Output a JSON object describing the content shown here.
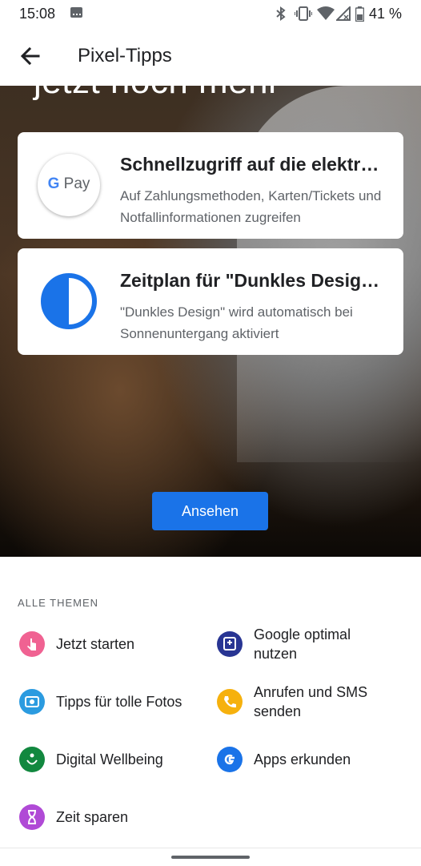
{
  "status_bar": {
    "time": "15:08",
    "battery_percent": "41 %",
    "icons": [
      "notification-icon",
      "bluetooth-icon",
      "vibrate-icon",
      "wifi-icon",
      "cell-signal-icon",
      "battery-icon"
    ]
  },
  "app_bar": {
    "title": "Pixel-Tipps",
    "back_icon": "arrow-back-icon"
  },
  "hero": {
    "headline": "jetzt noch mehr",
    "cards": [
      {
        "title": "Schnellzugriff auf die elektr…",
        "description": "Auf Zahlungsmethoden, Karten/Tickets und Notfallinformationen zugreifen",
        "icon": "google-pay-icon",
        "logo_g": "G",
        "logo_pay": "Pay"
      },
      {
        "title": "Zeitplan für \"Dunkles Desig…",
        "description": "\"Dunkles Design\" wird automatisch bei Sonnenuntergang aktiviert",
        "icon": "dark-theme-icon",
        "icon_color": "#1a73e8"
      }
    ],
    "cta_label": "Ansehen",
    "cta_color": "#1a73e8"
  },
  "topics": {
    "section_title": "ALLE THEMEN",
    "items": [
      {
        "label": "Jetzt starten",
        "icon": "touch-icon",
        "color": "#f06292"
      },
      {
        "label": "Google optimal nutzen",
        "icon": "google-assistant-icon",
        "color": "#283593"
      },
      {
        "label": "Tipps für tolle Fotos",
        "icon": "camera-icon",
        "color": "#2b9be0"
      },
      {
        "label": "Anrufen und SMS senden",
        "icon": "phone-icon",
        "color": "#f6b10d"
      },
      {
        "label": "Digital Wellbeing",
        "icon": "wellbeing-icon",
        "color": "#12883f"
      },
      {
        "label": "Apps erkunden",
        "icon": "google-g-icon",
        "color": "#1a73e8"
      },
      {
        "label": "Zeit sparen",
        "icon": "hourglass-icon",
        "color": "#b04ad6"
      }
    ]
  }
}
